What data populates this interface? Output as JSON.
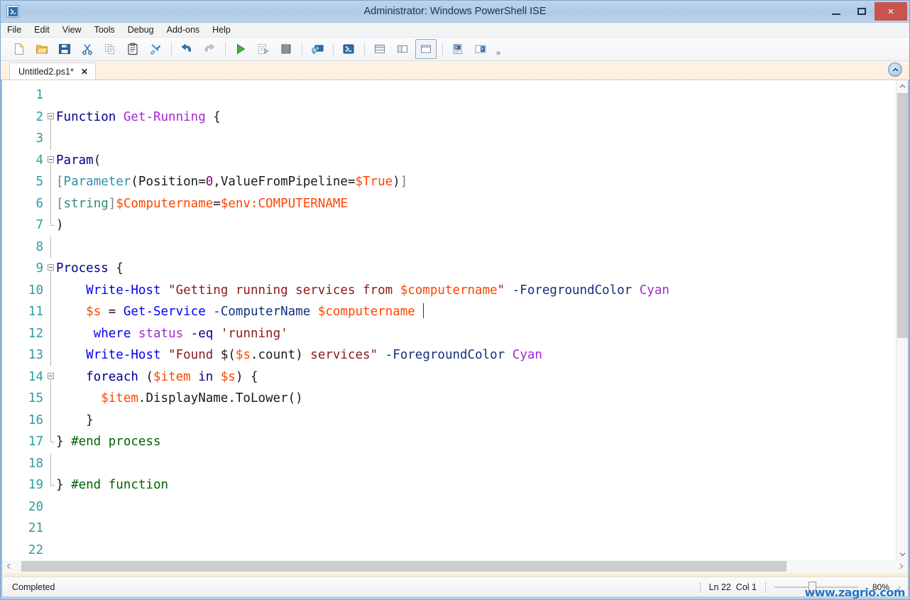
{
  "window": {
    "title": "Administrator: Windows PowerShell ISE",
    "app_icon": "powershell-ise-icon",
    "minimize_label": "",
    "maximize_label": "",
    "close_label": "×"
  },
  "menubar": {
    "items": [
      {
        "label": "File"
      },
      {
        "label": "Edit"
      },
      {
        "label": "View"
      },
      {
        "label": "Tools"
      },
      {
        "label": "Debug"
      },
      {
        "label": "Add-ons"
      },
      {
        "label": "Help"
      }
    ]
  },
  "toolbar": {
    "overflow_label": "»",
    "buttons": [
      {
        "name": "new-script-icon",
        "tooltip": "New"
      },
      {
        "name": "open-folder-icon",
        "tooltip": "Open"
      },
      {
        "name": "save-icon",
        "tooltip": "Save"
      },
      {
        "name": "cut-scissors-icon",
        "tooltip": "Cut"
      },
      {
        "name": "copy-icon",
        "tooltip": "Copy"
      },
      {
        "name": "paste-clipboard-icon",
        "tooltip": "Paste"
      },
      {
        "name": "clear-console-icon",
        "tooltip": "Clear Console Pane"
      },
      {
        "name": "undo-arrow-icon",
        "tooltip": "Undo"
      },
      {
        "name": "redo-arrow-icon",
        "tooltip": "Redo"
      },
      {
        "name": "run-script-icon",
        "tooltip": "Run Script"
      },
      {
        "name": "run-selection-icon",
        "tooltip": "Run Selection"
      },
      {
        "name": "stop-operation-icon",
        "tooltip": "Stop Operation"
      },
      {
        "name": "new-remote-tab-icon",
        "tooltip": "New Remote PowerShell Tab"
      },
      {
        "name": "start-powershell-icon",
        "tooltip": "Start PowerShell.exe"
      },
      {
        "name": "layout-horizontal-icon",
        "tooltip": "Show Script Pane Top"
      },
      {
        "name": "layout-vertical-icon",
        "tooltip": "Show Script Pane Right"
      },
      {
        "name": "layout-maximized-icon",
        "tooltip": "Show Script Pane Maximized"
      },
      {
        "name": "show-command-addon-icon",
        "tooltip": "Show Command Add-on"
      },
      {
        "name": "show-console-pane-icon",
        "tooltip": "Show Console Pane"
      }
    ]
  },
  "tabstrip": {
    "tab_label": "Untitled2.ps1*",
    "tab_close": "✕",
    "updown_icon": "chevron-up-circle-icon"
  },
  "editor": {
    "lines": [
      {
        "n": "1",
        "fold": "none",
        "tokens": []
      },
      {
        "n": "2",
        "fold": "open",
        "tokens": [
          {
            "c": "kw",
            "t": "Function"
          },
          {
            "c": "op",
            "t": " "
          },
          {
            "c": "fnname",
            "t": "Get-Running"
          },
          {
            "c": "op",
            "t": " {"
          }
        ]
      },
      {
        "n": "3",
        "fold": "line",
        "tokens": []
      },
      {
        "n": "4",
        "fold": "open",
        "tokens": [
          {
            "c": "kw",
            "t": "Param"
          },
          {
            "c": "op",
            "t": "("
          }
        ]
      },
      {
        "n": "5",
        "fold": "line",
        "tokens": [
          {
            "c": "brk",
            "t": "["
          },
          {
            "c": "type",
            "t": "Parameter"
          },
          {
            "c": "op",
            "t": "(Position="
          },
          {
            "c": "num",
            "t": "0"
          },
          {
            "c": "op",
            "t": ",ValueFromPipeline="
          },
          {
            "c": "var",
            "t": "$True"
          },
          {
            "c": "op",
            "t": ")"
          },
          {
            "c": "brk",
            "t": "]"
          }
        ]
      },
      {
        "n": "6",
        "fold": "line",
        "tokens": [
          {
            "c": "brk",
            "t": "["
          },
          {
            "c": "type2",
            "t": "string"
          },
          {
            "c": "brk",
            "t": "]"
          },
          {
            "c": "var",
            "t": "$Computername"
          },
          {
            "c": "op",
            "t": "="
          },
          {
            "c": "var",
            "t": "$env:COMPUTERNAME"
          }
        ]
      },
      {
        "n": "7",
        "fold": "endline",
        "tokens": [
          {
            "c": "op",
            "t": ")"
          }
        ]
      },
      {
        "n": "8",
        "fold": "line",
        "tokens": []
      },
      {
        "n": "9",
        "fold": "open",
        "tokens": [
          {
            "c": "kw",
            "t": "Process"
          },
          {
            "c": "op",
            "t": " {"
          }
        ]
      },
      {
        "n": "10",
        "fold": "line",
        "tokens": [
          {
            "c": "op",
            "t": "    "
          },
          {
            "c": "cmdlet",
            "t": "Write-Host"
          },
          {
            "c": "op",
            "t": " "
          },
          {
            "c": "str",
            "t": "\"Getting running services from "
          },
          {
            "c": "var",
            "t": "$computername"
          },
          {
            "c": "str",
            "t": "\""
          },
          {
            "c": "op",
            "t": " "
          },
          {
            "c": "param",
            "t": "-ForegroundColor"
          },
          {
            "c": "op",
            "t": " "
          },
          {
            "c": "member",
            "t": "Cyan"
          }
        ]
      },
      {
        "n": "11",
        "fold": "line",
        "tokens": [
          {
            "c": "op",
            "t": "    "
          },
          {
            "c": "var",
            "t": "$s"
          },
          {
            "c": "op",
            "t": " = "
          },
          {
            "c": "cmdlet",
            "t": "Get-Service"
          },
          {
            "c": "op",
            "t": " "
          },
          {
            "c": "param",
            "t": "-ComputerName"
          },
          {
            "c": "op",
            "t": " "
          },
          {
            "c": "var",
            "t": "$computername"
          },
          {
            "c": "op",
            "t": " "
          },
          {
            "c": "caret",
            "t": "|"
          }
        ]
      },
      {
        "n": "12",
        "fold": "line",
        "tokens": [
          {
            "c": "op",
            "t": "     "
          },
          {
            "c": "cmdlet",
            "t": "where"
          },
          {
            "c": "op",
            "t": " "
          },
          {
            "c": "member",
            "t": "status"
          },
          {
            "c": "op",
            "t": " "
          },
          {
            "c": "kw",
            "t": "-eq"
          },
          {
            "c": "op",
            "t": " "
          },
          {
            "c": "str",
            "t": "'running'"
          }
        ]
      },
      {
        "n": "13",
        "fold": "line",
        "tokens": [
          {
            "c": "op",
            "t": "    "
          },
          {
            "c": "cmdlet",
            "t": "Write-Host"
          },
          {
            "c": "op",
            "t": " "
          },
          {
            "c": "str",
            "t": "\"Found "
          },
          {
            "c": "op",
            "t": "$("
          },
          {
            "c": "var",
            "t": "$s"
          },
          {
            "c": "op",
            "t": ".count)"
          },
          {
            "c": "str",
            "t": " services\""
          },
          {
            "c": "op",
            "t": " "
          },
          {
            "c": "param",
            "t": "-ForegroundColor"
          },
          {
            "c": "op",
            "t": " "
          },
          {
            "c": "member",
            "t": "Cyan"
          }
        ]
      },
      {
        "n": "14",
        "fold": "open",
        "tokens": [
          {
            "c": "op",
            "t": "    "
          },
          {
            "c": "kw",
            "t": "foreach"
          },
          {
            "c": "op",
            "t": " ("
          },
          {
            "c": "var",
            "t": "$item"
          },
          {
            "c": "op",
            "t": " "
          },
          {
            "c": "kw",
            "t": "in"
          },
          {
            "c": "op",
            "t": " "
          },
          {
            "c": "var",
            "t": "$s"
          },
          {
            "c": "op",
            "t": ") {"
          }
        ]
      },
      {
        "n": "15",
        "fold": "line",
        "tokens": [
          {
            "c": "op",
            "t": "      "
          },
          {
            "c": "var",
            "t": "$item"
          },
          {
            "c": "op",
            "t": ".DisplayName"
          },
          {
            "c": "op",
            "t": ".ToLower()"
          }
        ]
      },
      {
        "n": "16",
        "fold": "line",
        "tokens": [
          {
            "c": "op",
            "t": "    }"
          }
        ]
      },
      {
        "n": "17",
        "fold": "endline",
        "tokens": [
          {
            "c": "op",
            "t": "} "
          },
          {
            "c": "comment",
            "t": "#end process"
          }
        ]
      },
      {
        "n": "18",
        "fold": "line",
        "tokens": []
      },
      {
        "n": "19",
        "fold": "endline",
        "tokens": [
          {
            "c": "op",
            "t": "} "
          },
          {
            "c": "comment",
            "t": "#end function"
          }
        ]
      },
      {
        "n": "20",
        "fold": "none",
        "tokens": []
      },
      {
        "n": "21",
        "fold": "none",
        "tokens": []
      },
      {
        "n": "22",
        "fold": "none",
        "tokens": []
      }
    ]
  },
  "scrollbars": {
    "vertical_up": "▲",
    "vertical_down": "▼",
    "horizontal_left": "◀",
    "horizontal_right": "▶"
  },
  "statusbar": {
    "status": "Completed",
    "line_col": "Ln 22  Col 1",
    "zoom_percent": "80%"
  },
  "watermark": {
    "text": "www.zagrio.com"
  }
}
